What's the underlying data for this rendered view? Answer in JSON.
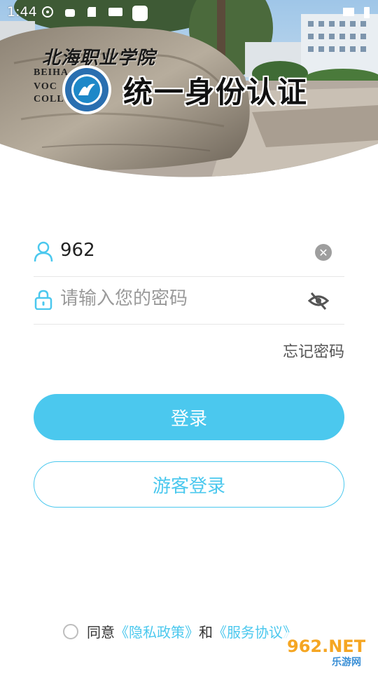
{
  "status_bar": {
    "time": "1:44"
  },
  "header": {
    "college_name": "北海职业学院",
    "college_en_line1": "BEIHA",
    "college_en_line2": "VOC",
    "college_en_line3": "COLL",
    "title": "统一身份认证"
  },
  "form": {
    "username_value": "962",
    "password_placeholder": "请输入您的密码",
    "forgot_label": "忘记密码"
  },
  "buttons": {
    "login_label": "登录",
    "guest_label": "游客登录"
  },
  "agreement": {
    "prefix": "同意",
    "privacy_link": "《隐私政策》",
    "and": "和",
    "service_link": "《服务协议》"
  },
  "watermark": {
    "brand": "962.NET",
    "sub": "乐游网"
  },
  "colors": {
    "accent": "#4bc8ee",
    "text": "#222222",
    "placeholder": "#9a9a9a"
  },
  "icons": [
    "user-icon",
    "lock-icon",
    "clear-icon",
    "eye-off-icon",
    "radio-icon"
  ]
}
